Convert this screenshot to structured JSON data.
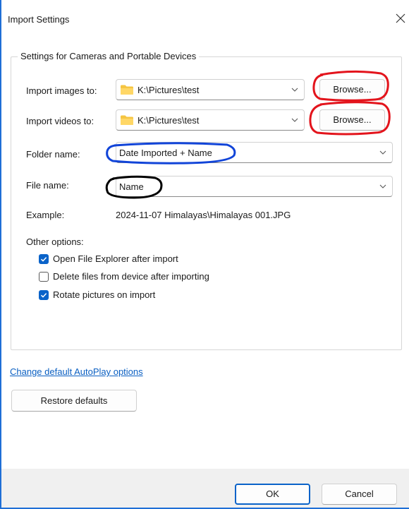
{
  "dialog": {
    "title": "Import Settings"
  },
  "group": {
    "legend": "Settings for Cameras and Portable Devices"
  },
  "import_images": {
    "label": "Import images to:",
    "value": "K:\\Pictures\\test",
    "browse_label": "Browse..."
  },
  "import_videos": {
    "label": "Import videos to:",
    "value": "K:\\Pictures\\test",
    "browse_label": "Browse..."
  },
  "folder_name": {
    "label": "Folder name:",
    "value": "Date Imported + Name"
  },
  "file_name": {
    "label": "File name:",
    "value": "Name"
  },
  "example": {
    "label": "Example:",
    "value": "2024-11-07 Himalayas\\Himalayas 001.JPG"
  },
  "other_options": {
    "label": "Other options:",
    "items": [
      {
        "label": "Open File Explorer after import",
        "checked": true
      },
      {
        "label": "Delete files from device after importing",
        "checked": false
      },
      {
        "label": "Rotate pictures on import",
        "checked": true
      }
    ]
  },
  "links": {
    "autoplay": "Change default AutoPlay options"
  },
  "buttons": {
    "restore": "Restore defaults",
    "ok": "OK",
    "cancel": "Cancel"
  },
  "colors": {
    "accent": "#0a63c9",
    "link": "#0a5fc2",
    "annotation_red": "#e3141c",
    "annotation_blue": "#1144d8",
    "annotation_black": "#000000",
    "folder": "#f5c542"
  }
}
